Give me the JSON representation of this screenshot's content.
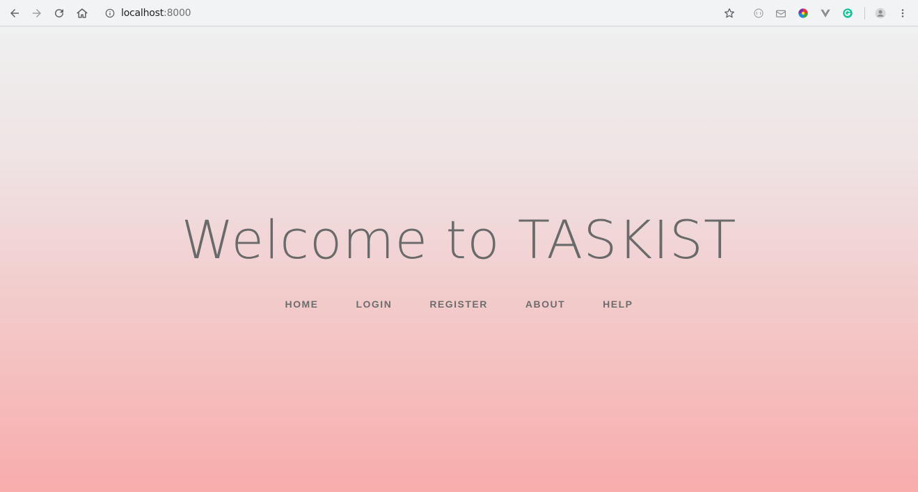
{
  "browser": {
    "url_host": "localhost",
    "url_port": ":8000",
    "icons": {
      "back": "back-arrow-icon",
      "forward": "forward-arrow-icon",
      "reload": "reload-icon",
      "home": "home-icon",
      "info": "info-icon",
      "bookmark": "star-icon",
      "menu": "more-vert-icon"
    }
  },
  "hero": {
    "title": "Welcome to TASKIST"
  },
  "nav": {
    "items": [
      {
        "label": "HOME"
      },
      {
        "label": "LOGIN"
      },
      {
        "label": "REGISTER"
      },
      {
        "label": "ABOUT"
      },
      {
        "label": "HELP"
      }
    ]
  },
  "colors": {
    "gradient_top": "#eff0f0",
    "gradient_bottom": "#f8acac",
    "text": "#6a6a6a"
  }
}
